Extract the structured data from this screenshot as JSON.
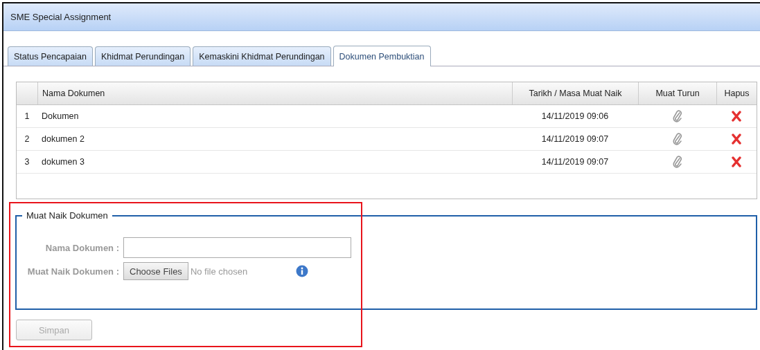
{
  "window": {
    "title": "SME Special Assignment"
  },
  "tabs": [
    {
      "label": "Status Pencapaian",
      "selected": false
    },
    {
      "label": "Khidmat Perundingan",
      "selected": false
    },
    {
      "label": "Kemaskini Khidmat Perundingan",
      "selected": false
    },
    {
      "label": "Dokumen Pembuktian",
      "selected": true
    }
  ],
  "table": {
    "columns": [
      "Nama Dokumen",
      "Tarikh / Masa Muat Naik",
      "Muat Turun",
      "Hapus"
    ],
    "rows": [
      {
        "index": "1",
        "name": "Dokumen",
        "uploaded": "14/11/2019 09:06"
      },
      {
        "index": "2",
        "name": "dokumen 2",
        "uploaded": "14/11/2019 09:07"
      },
      {
        "index": "3",
        "name": "dokumen 3",
        "uploaded": "14/11/2019 09:07"
      }
    ]
  },
  "upload_form": {
    "legend": "Muat Naik Dokumen",
    "name_label": "Nama Dokumen :",
    "file_label": "Muat Naik Dokumen :",
    "choose_button": "Choose Files",
    "file_status": "No file chosen"
  },
  "save_button": {
    "label": "Simpan",
    "disabled": true
  }
}
